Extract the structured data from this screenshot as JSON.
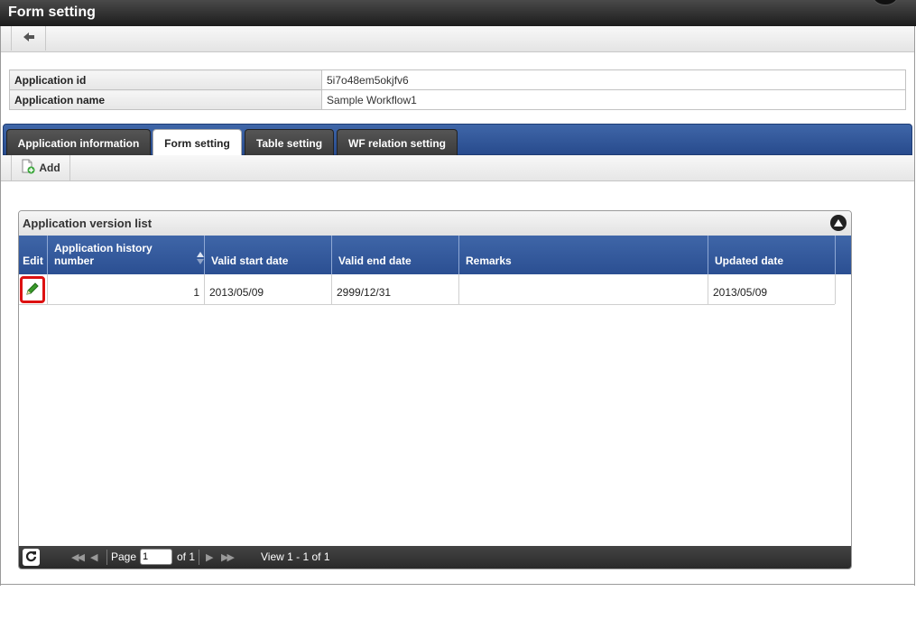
{
  "window": {
    "title": "Form setting"
  },
  "info": {
    "rows": [
      {
        "label": "Application id",
        "value": "5i7o48em5okjfv6"
      },
      {
        "label": "Application name",
        "value": "Sample Workflow1"
      }
    ]
  },
  "tabs": [
    {
      "label": "Application information"
    },
    {
      "label": "Form setting"
    },
    {
      "label": "Table setting"
    },
    {
      "label": "WF relation setting"
    }
  ],
  "toolbar": {
    "add_label": "Add"
  },
  "grid": {
    "caption": "Application version list",
    "columns": [
      "Edit",
      "Application history number",
      "Valid start date",
      "Valid end date",
      "Remarks",
      "Updated date"
    ],
    "rows": [
      {
        "history_number": "1",
        "valid_start": "2013/05/09",
        "valid_end": "2999/12/31",
        "remarks": "",
        "updated": "2013/05/09"
      }
    ],
    "pager": {
      "page_label": "Page",
      "page_value": "1",
      "of_label": "of 1",
      "view_text": "View 1 - 1 of 1"
    }
  },
  "icons": {
    "back": "arrow-left-icon",
    "add": "add-document-icon",
    "edit": "pencil-icon",
    "collapse": "triangle-up-icon",
    "refresh": "refresh-icon"
  },
  "colors": {
    "tab_bar": "#2f549a",
    "header": "#33589c",
    "edit_highlight": "#dd1111"
  }
}
